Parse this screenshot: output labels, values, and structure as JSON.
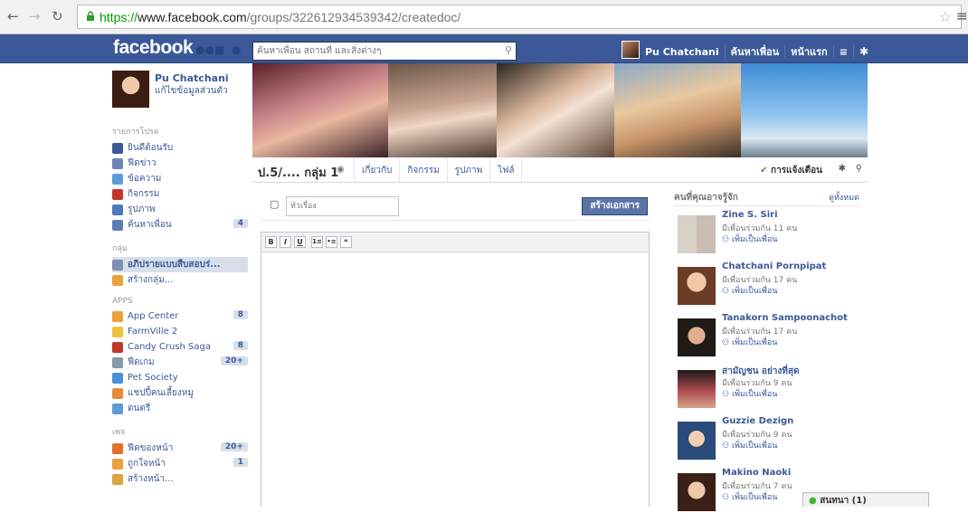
{
  "browser": {
    "url_proto": "https://",
    "url_host": "www.facebook.com",
    "url_path": "/groups/322612934539342/createdoc/"
  },
  "topbar": {
    "logo": "facebook",
    "search_placeholder": "ค้นหาเพื่อน สถานที่ และสิ่งต่างๆ",
    "user_name": "Pu Chatchani",
    "find_friends": "ค้นหาเพื่อน",
    "home": "หน้าแรก"
  },
  "left": {
    "name": "Pu Chatchani",
    "edit_profile": "แก้ไขข้อมูลส่วนตัว",
    "favorites_heading": "รายการโปรด",
    "favorites": [
      {
        "label": "ยินดีต้อนรับ",
        "icon": "welcome-icon",
        "color": "#3b5998"
      },
      {
        "label": "ฟีดข่าว",
        "icon": "news-feed-icon",
        "color": "#6d84b4"
      },
      {
        "label": "ข้อความ",
        "icon": "messages-icon",
        "color": "#5d9bd5"
      },
      {
        "label": "กิจกรรม",
        "icon": "events-icon",
        "color": "#c0392b"
      },
      {
        "label": "รูปภาพ",
        "icon": "photos-icon",
        "color": "#4a7bb8"
      },
      {
        "label": "ค้นหาเพื่อน",
        "icon": "find-friends-icon",
        "color": "#5f7cb3",
        "count": "4"
      }
    ],
    "groups_heading": "กลุ่ม",
    "groups": [
      {
        "label": "อภิปรายแบบสืบสอบร่...",
        "icon": "group-icon",
        "color": "#7f8fb0",
        "active": true
      },
      {
        "label": "สร้างกลุ่ม...",
        "icon": "create-group-icon",
        "color": "#e8a33d"
      }
    ],
    "apps_heading": "APPS",
    "apps": [
      {
        "label": "App Center",
        "icon": "app-center-icon",
        "color": "#e8a33d",
        "count": "8"
      },
      {
        "label": "FarmVille 2",
        "icon": "farmville-icon",
        "color": "#f0c040"
      },
      {
        "label": "Candy Crush Saga",
        "icon": "candy-crush-icon",
        "color": "#c0392b",
        "count": "8"
      },
      {
        "label": "ฟีดเกม",
        "icon": "games-feed-icon",
        "color": "#8899aa",
        "count": "20+"
      },
      {
        "label": "Pet Society",
        "icon": "pet-society-icon",
        "color": "#4a90d9"
      },
      {
        "label": "แชปปี้คนเลี้ยงหมู",
        "icon": "app-icon",
        "color": "#e58a3c"
      },
      {
        "label": "ดนตรี",
        "icon": "music-icon",
        "color": "#5d9bd5"
      }
    ],
    "pages_heading": "เพจ",
    "pages": [
      {
        "label": "ฟีดของหน้า",
        "icon": "pages-feed-icon",
        "color": "#e0702a",
        "count": "20+"
      },
      {
        "label": "ถูกใจหน้า",
        "icon": "like-pages-icon",
        "color": "#e8a33d",
        "count": "1"
      },
      {
        "label": "สร้างหน้า...",
        "icon": "create-page-icon",
        "color": "#d9a441"
      }
    ]
  },
  "group": {
    "name": "ป.5/.... กลุ่ม 1",
    "tabs": [
      "เกี่ยวกับ",
      "กิจกรรม",
      "รูปภาพ",
      "ไฟล์"
    ],
    "notifications": "การแจ้งเตือน"
  },
  "composer": {
    "title_placeholder": "หัวเรื่อง",
    "create_button": "สร้างเอกสาร"
  },
  "editor": {
    "tools": [
      "B",
      "I",
      "U",
      "1≡",
      "•≡",
      "❝"
    ]
  },
  "pymk": {
    "title": "คนที่คุณอาจรู้จัก",
    "see_all": "ดูทั้งหมด",
    "add_friend": "เพิ่มเป็นเพื่อน",
    "people": [
      {
        "name": "Zine S. Siri",
        "mutual": "มีเพื่อนร่วมกัน 11 คน"
      },
      {
        "name": "Chatchani Pornpipat",
        "mutual": "มีเพื่อนร่วมกัน 17 คน"
      },
      {
        "name": "Tanakorn Sampoonachot",
        "mutual": "มีเพื่อนร่วมกัน 17 คน"
      },
      {
        "name": "สามัญชน อย่างที่สุด",
        "mutual": "มีเพื่อนร่วมกัน 9 คน"
      },
      {
        "name": "Guzzie Dezign",
        "mutual": "มีเพื่อนร่วมกัน 9 คน"
      },
      {
        "name": "Makino Naoki",
        "mutual": "มีเพื่อนร่วมกัน 7 คน"
      }
    ]
  },
  "chat": {
    "label": "สนทนา (1)"
  }
}
